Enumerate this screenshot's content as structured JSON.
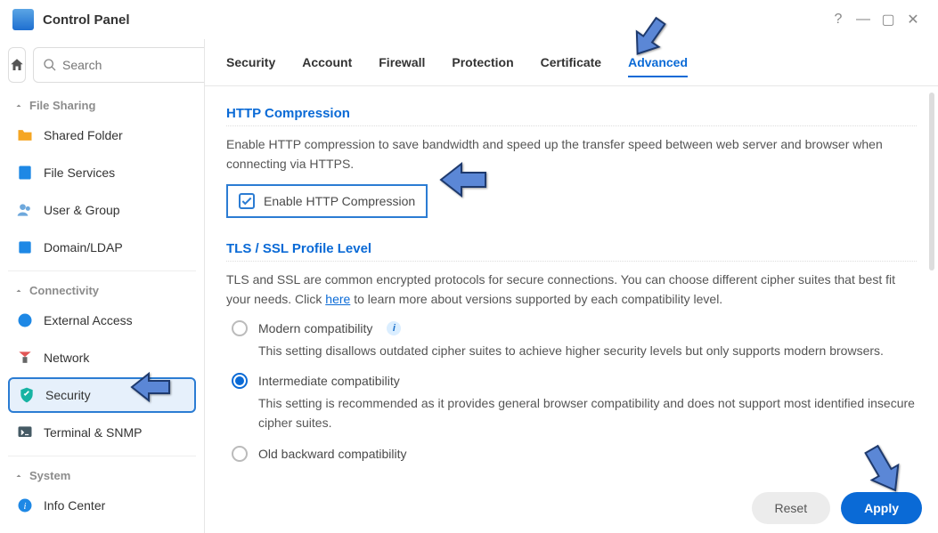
{
  "window": {
    "title": "Control Panel"
  },
  "search": {
    "placeholder": "Search"
  },
  "sidebar": {
    "groups": {
      "file_sharing": "File Sharing",
      "connectivity": "Connectivity",
      "system": "System"
    },
    "items": {
      "shared_folder": "Shared Folder",
      "file_services": "File Services",
      "user_group": "User & Group",
      "domain_ldap": "Domain/LDAP",
      "external_access": "External Access",
      "network": "Network",
      "security": "Security",
      "terminal_snmp": "Terminal & SNMP",
      "info_center": "Info Center"
    }
  },
  "tabs": {
    "security": "Security",
    "account": "Account",
    "firewall": "Firewall",
    "protection": "Protection",
    "certificate": "Certificate",
    "advanced": "Advanced"
  },
  "sections": {
    "http_compression": {
      "title": "HTTP Compression",
      "desc": "Enable HTTP compression to save bandwidth and speed up the transfer speed between web server and browser when connecting via HTTPS.",
      "checkbox_label": "Enable HTTP Compression",
      "checked": true
    },
    "tls": {
      "title": "TLS / SSL Profile Level",
      "desc_prefix": "TLS and SSL are common encrypted protocols for secure connections. You can choose different cipher suites that best fit your needs. Click ",
      "link_text": "here",
      "desc_suffix": " to learn more about versions supported by each compatibility level.",
      "options": {
        "modern": {
          "label": "Modern compatibility",
          "desc": "This setting disallows outdated cipher suites to achieve higher security levels but only supports modern browsers."
        },
        "intermediate": {
          "label": "Intermediate compatibility",
          "desc": "This setting is recommended as it provides general browser compatibility and does not support most identified insecure cipher suites."
        },
        "old": {
          "label": "Old backward compatibility"
        }
      },
      "selected": "intermediate"
    }
  },
  "footer": {
    "reset": "Reset",
    "apply": "Apply"
  }
}
